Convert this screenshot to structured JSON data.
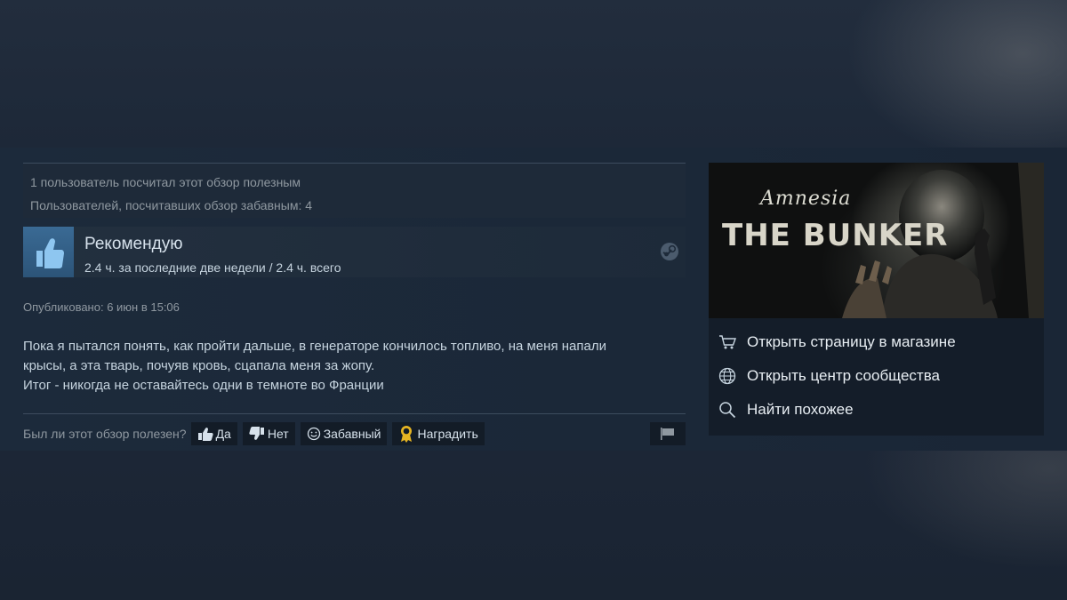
{
  "review": {
    "helpful_count_text": "1 пользователь посчитал этот обзор полезным",
    "funny_count_text": "Пользователей, посчитавших обзор забавным: 4",
    "recommendation": "Рекомендую",
    "hours_text": "2.4 ч. за последние две недели / 2.4 ч. всего",
    "posted_text": "Опубликовано: 6 июн в 15:06",
    "body_lines": [
      "Пока я пытался понять, как пройти дальше, в генераторе кончилось топливо, на меня напали",
      "крысы, а эта тварь, почуяв кровь, сцапала меня за жопу.",
      "Итог - никогда не оставайтесь одни в темноте во Франции"
    ],
    "helpful_question": "Был ли этот обзор полезен?",
    "buttons": {
      "yes": "Да",
      "no": "Нет",
      "funny": "Забавный",
      "award": "Наградить"
    }
  },
  "game": {
    "capsule_title_top": "Amnesia",
    "capsule_title_main": "THE BUNKER"
  },
  "side_links": [
    {
      "icon": "cart-icon",
      "label": "Открыть страницу в магазине"
    },
    {
      "icon": "globe-icon",
      "label": "Открыть центр сообщества"
    },
    {
      "icon": "search-icon",
      "label": "Найти похожее"
    }
  ],
  "colors": {
    "background": "#1b2838",
    "thumb_blue": "#3a6a94",
    "button_bg": "#131c27",
    "award_gold": "#e6b422",
    "text_muted": "#8f98a0"
  }
}
